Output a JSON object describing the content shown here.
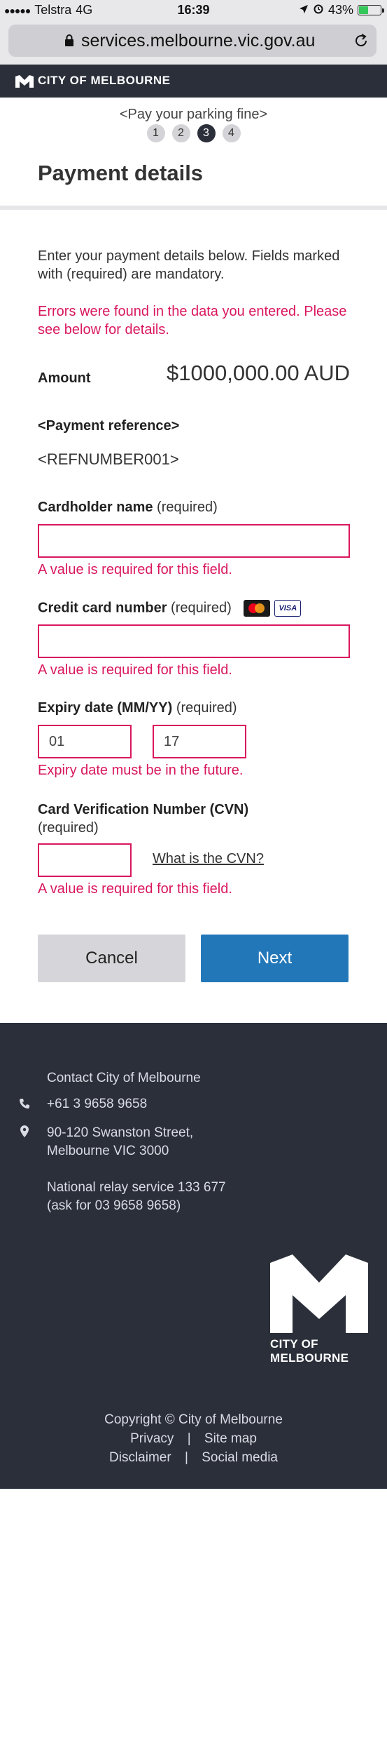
{
  "status_bar": {
    "carrier": "Telstra",
    "network": "4G",
    "time": "16:39",
    "battery": "43%",
    "battery_level": 0.43
  },
  "browser": {
    "url": "services.melbourne.vic.gov.au"
  },
  "brand": {
    "name": "CITY OF MELBOURNE"
  },
  "steps": {
    "title": "<Pay your parking fine>",
    "items": [
      "1",
      "2",
      "3",
      "4"
    ],
    "active": 3
  },
  "page": {
    "title": "Payment details",
    "intro": "Enter your payment details below. Fields marked with (required) are mandatory.",
    "error_summary": "Errors were found in the data you entered. Please see below for details."
  },
  "amount": {
    "label": "Amount",
    "value": "$1000,000.00 AUD"
  },
  "payment_reference": {
    "label": "<Payment reference>",
    "value": "<REFNUMBER001>"
  },
  "fields": {
    "cardholder": {
      "label": "Cardholder name",
      "required": "(required)",
      "value": "",
      "error": "A value is required for this field."
    },
    "card_number": {
      "label": "Credit card number",
      "required": "(required)",
      "value": "",
      "error": "A value is required for this field.",
      "card_logos": [
        "mastercard-icon",
        "visa-icon"
      ],
      "visa_text": "VISA"
    },
    "expiry": {
      "label": "Expiry date (MM/YY)",
      "required": "(required)",
      "month": "01",
      "year": "17",
      "error": "Expiry date must be in the future."
    },
    "cvn": {
      "label": "Card Verification Number (CVN)",
      "required": "(required)",
      "value": "",
      "help_link": "What is the CVN?",
      "error": "A value is required for this field."
    }
  },
  "buttons": {
    "cancel": "Cancel",
    "next": "Next"
  },
  "footer": {
    "contact_title": "Contact City of Melbourne",
    "phone": "+61 3 9658 9658",
    "address_line1": "90-120 Swanston Street,",
    "address_line2": "Melbourne VIC 3000",
    "relay_line1": "National relay service 133 677",
    "relay_line2": "(ask for 03 9658 9658)",
    "logo_text": "CITY OF MELBOURNE",
    "copyright": "Copyright ©  City of Melbourne",
    "links": [
      "Privacy",
      "Site map",
      "Disclaimer",
      "Social media"
    ],
    "separator": "|"
  },
  "colors": {
    "brand_dark": "#2b2f3a",
    "error": "#d9175e",
    "primary": "#2277b9",
    "secondary_button": "#d6d6da"
  }
}
